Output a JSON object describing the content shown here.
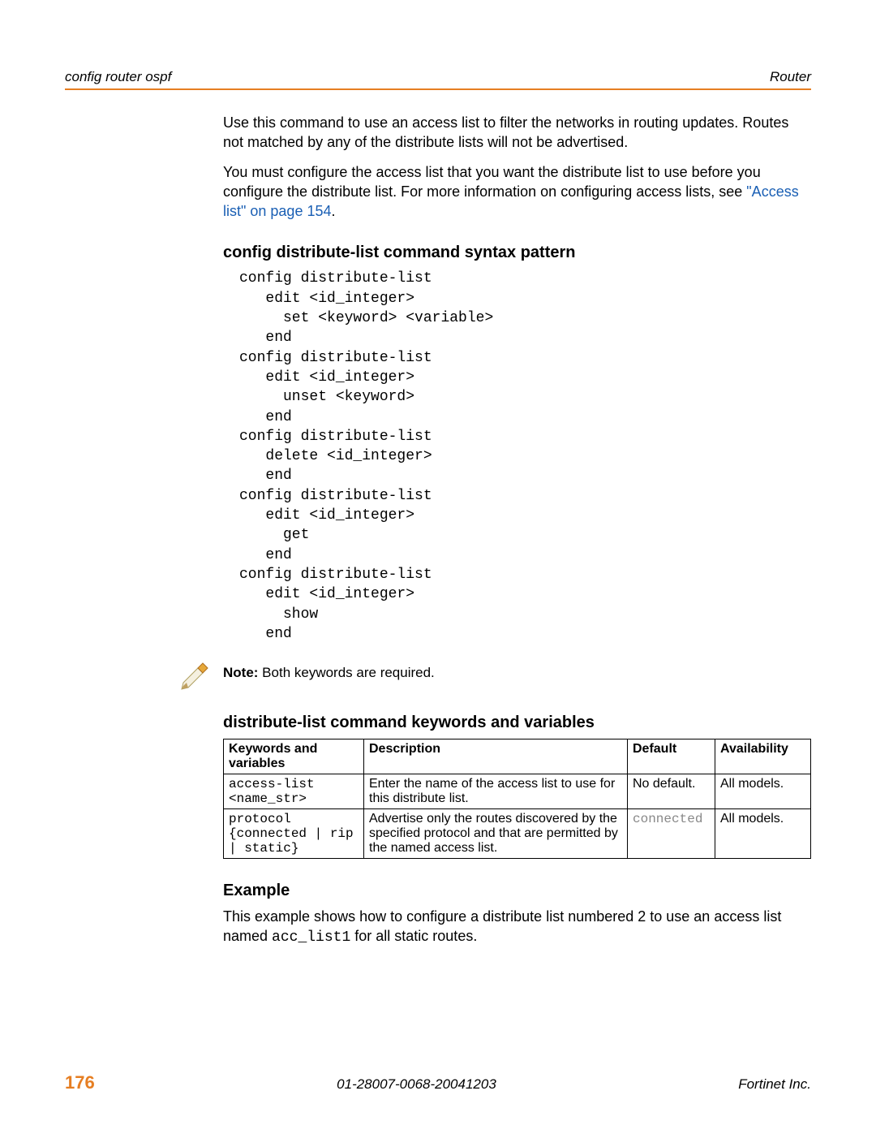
{
  "header": {
    "left": "config router ospf",
    "right": "Router"
  },
  "intro": {
    "p1": "Use this command to use an access list to filter the networks in routing updates. Routes not matched by any of the distribute lists will not be advertised.",
    "p2a": "You must configure the access list that you want the distribute list to use before you configure the distribute list. For more information on configuring access lists, see ",
    "link": "\"Access list\" on page 154",
    "p2b": "."
  },
  "syntax": {
    "heading": "config distribute-list command syntax pattern",
    "code": "config distribute-list\n   edit <id_integer>\n     set <keyword> <variable>\n   end\nconfig distribute-list\n   edit <id_integer>\n     unset <keyword>\n   end\nconfig distribute-list\n   delete <id_integer>\n   end\nconfig distribute-list\n   edit <id_integer>\n     get\n   end\nconfig distribute-list\n   edit <id_integer>\n     show\n   end"
  },
  "note": {
    "label": "Note:",
    "text": " Both keywords are required."
  },
  "table": {
    "heading": "distribute-list command keywords and variables",
    "headers": {
      "kw": "Keywords and variables",
      "desc": "Description",
      "def": "Default",
      "avail": "Availability"
    },
    "rows": [
      {
        "kw": "access-list <name_str>",
        "desc": "Enter the name of the access list to use for this distribute list.",
        "def": "No default.",
        "def_grey": false,
        "avail": "All models."
      },
      {
        "kw": "protocol {connected | rip | static}",
        "desc": "Advertise only the routes discovered by the specified protocol and that are permitted by the named access list.",
        "def": "connected",
        "def_grey": true,
        "avail": "All models."
      }
    ]
  },
  "example": {
    "heading": "Example",
    "text_a": "This example shows how to configure a distribute list numbered 2 to use an access list named ",
    "code": "acc_list1",
    "text_b": " for all static routes."
  },
  "footer": {
    "page": "176",
    "docid": "01-28007-0068-20041203",
    "vendor": "Fortinet Inc."
  }
}
